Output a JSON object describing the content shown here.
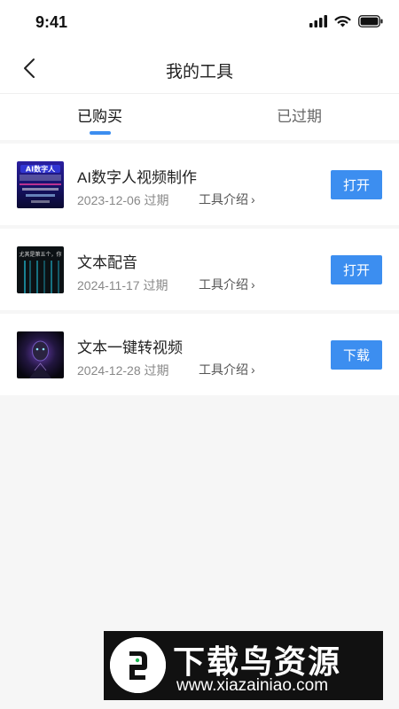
{
  "status_bar": {
    "time": "9:41",
    "icons": [
      "cellular-signal-icon",
      "wifi-icon",
      "battery-icon"
    ]
  },
  "nav": {
    "title": "我的工具",
    "back_icon": "chevron-left-icon"
  },
  "tabs": [
    {
      "label": "已购买",
      "active": true
    },
    {
      "label": "已过期",
      "active": false
    }
  ],
  "tools": [
    {
      "name": "AI数字人视频制作",
      "expire": "2023-12-06 过期",
      "intro_label": "工具介绍",
      "action_label": "打开",
      "thumb_text": "AI数字人"
    },
    {
      "name": "文本配音",
      "expire": "2024-11-17 过期",
      "intro_label": "工具介绍",
      "action_label": "打开",
      "thumb_text": "尤其是第五个，你"
    },
    {
      "name": "文本一键转视频",
      "expire": "2024-12-28 过期",
      "intro_label": "工具介绍",
      "action_label": "下载",
      "thumb_text": ""
    }
  ],
  "watermark": {
    "title": "下载鸟资源",
    "url": "www.xiazainiao.com"
  },
  "colors": {
    "accent": "#3c8ef0",
    "background": "#f6f6f6",
    "card": "#ffffff"
  }
}
